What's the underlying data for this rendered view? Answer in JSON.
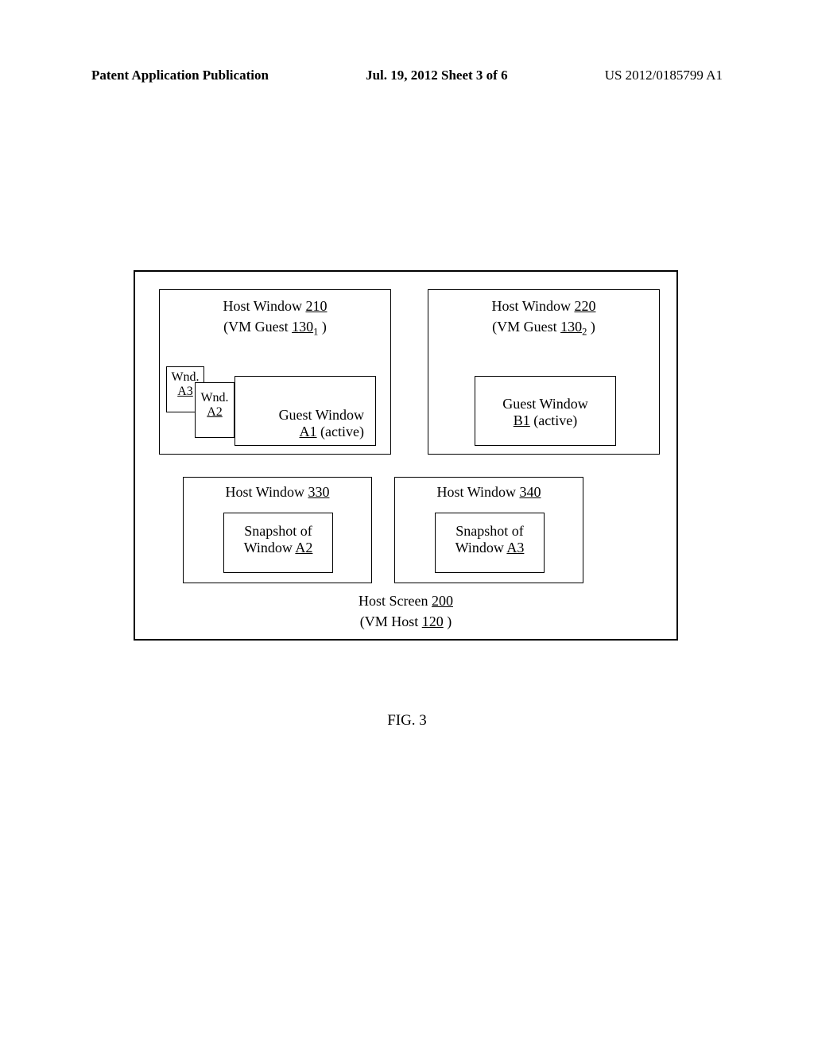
{
  "header": {
    "left": "Patent Application Publication",
    "center": "Jul. 19, 2012  Sheet 3 of 6",
    "right": "US 2012/0185799 A1"
  },
  "diagram": {
    "host_window_210": {
      "title_prefix": "Host Window ",
      "title_num": "210",
      "subtitle_prefix": "(VM Guest  ",
      "subtitle_num": "130",
      "subtitle_sub": "1",
      "subtitle_suffix": " )",
      "wnd_a3_prefix": "Wnd.",
      "wnd_a3_num": "A3",
      "wnd_a2_prefix": "Wnd.",
      "wnd_a2_num": "A2",
      "guest_a1_prefix": "Guest Window",
      "guest_a1_num": "A1",
      "guest_a1_suffix": " (active)"
    },
    "host_window_220": {
      "title_prefix": "Host Window ",
      "title_num": "220",
      "subtitle_prefix": "(VM Guest  ",
      "subtitle_num": "130",
      "subtitle_sub": "2",
      "subtitle_suffix": " )",
      "guest_b1_prefix": "Guest Window",
      "guest_b1_num": "B1",
      "guest_b1_suffix": "  (active)"
    },
    "host_window_330": {
      "title_prefix": "Host Window ",
      "title_num": "330",
      "snapshot_prefix": "Snapshot of",
      "snapshot_window_prefix": "Window ",
      "snapshot_num": "A2"
    },
    "host_window_340": {
      "title_prefix": "Host Window ",
      "title_num": "340",
      "snapshot_prefix": "Snapshot of",
      "snapshot_window_prefix": "Window ",
      "snapshot_num": "A3"
    },
    "host_screen": {
      "label_prefix": "Host Screen   ",
      "label_num": "200",
      "sublabel_prefix": "(VM Host  ",
      "sublabel_num": "120",
      "sublabel_suffix": " )"
    }
  },
  "figure_caption": "FIG. 3"
}
